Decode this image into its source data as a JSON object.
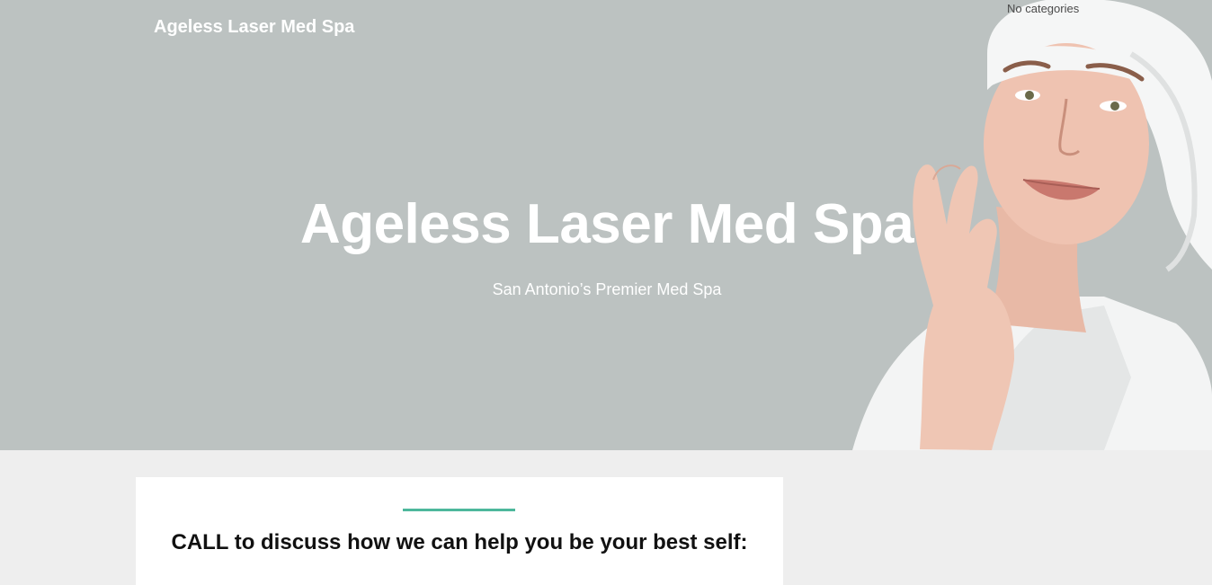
{
  "header": {
    "site_title": "Ageless Laser Med Spa",
    "categories_text": "No categories"
  },
  "hero": {
    "heading": "Ageless Laser Med Spa",
    "subheading": "San Antonio’s Premier Med Spa",
    "background_color": "#bcc2c1",
    "image_icon": "spa-model-photo"
  },
  "content": {
    "accent_color": "#4db89c",
    "cta_heading": "CALL to discuss how we can help you be your best self:"
  }
}
